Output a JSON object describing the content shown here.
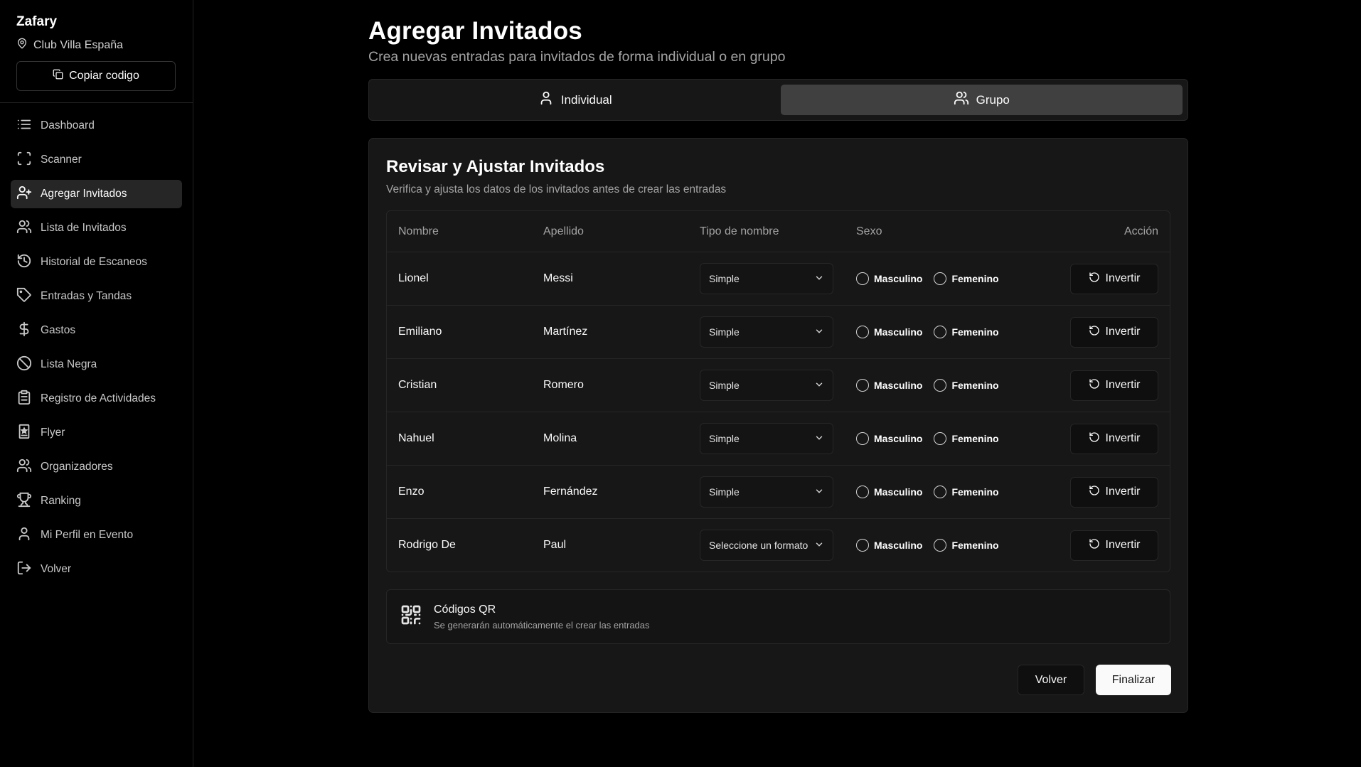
{
  "sidebar": {
    "brand": "Zafary",
    "venue": "Club Villa España",
    "copy_label": "Copiar codigo",
    "items": [
      {
        "label": "Dashboard",
        "icon": "list-icon"
      },
      {
        "label": "Scanner",
        "icon": "scan-icon"
      },
      {
        "label": "Agregar Invitados",
        "icon": "user-plus-icon",
        "active": true
      },
      {
        "label": "Lista de Invitados",
        "icon": "users-icon"
      },
      {
        "label": "Historial de Escaneos",
        "icon": "history-icon"
      },
      {
        "label": "Entradas y Tandas",
        "icon": "tag-icon"
      },
      {
        "label": "Gastos",
        "icon": "dollar-icon"
      },
      {
        "label": "Lista Negra",
        "icon": "ban-icon"
      },
      {
        "label": "Registro de Actividades",
        "icon": "clipboard-icon"
      },
      {
        "label": "Flyer",
        "icon": "flyer-icon"
      },
      {
        "label": "Organizadores",
        "icon": "users-icon"
      },
      {
        "label": "Ranking",
        "icon": "trophy-icon"
      },
      {
        "label": "Mi Perfil en Evento",
        "icon": "user-icon"
      },
      {
        "label": "Volver",
        "icon": "logout-icon"
      }
    ]
  },
  "header": {
    "title": "Agregar Invitados",
    "subtitle": "Crea nuevas entradas para invitados de forma individual o en grupo"
  },
  "tabs": [
    {
      "label": "Individual",
      "active": false
    },
    {
      "label": "Grupo",
      "active": true
    }
  ],
  "card": {
    "title": "Revisar y Ajustar Invitados",
    "subtitle": "Verifica y ajusta los datos de los invitados antes de crear las entradas",
    "columns": [
      "Nombre",
      "Apellido",
      "Tipo de nombre",
      "Sexo",
      "Acción"
    ],
    "radio_labels": [
      "Masculino",
      "Femenino"
    ],
    "action_label": "Invertir",
    "rows": [
      {
        "nombre": "Lionel",
        "apellido": "Messi",
        "tipo": "Simple"
      },
      {
        "nombre": "Emiliano",
        "apellido": "Martínez",
        "tipo": "Simple"
      },
      {
        "nombre": "Cristian",
        "apellido": "Romero",
        "tipo": "Simple"
      },
      {
        "nombre": "Nahuel",
        "apellido": "Molina",
        "tipo": "Simple"
      },
      {
        "nombre": "Enzo",
        "apellido": "Fernández",
        "tipo": "Simple"
      },
      {
        "nombre": "Rodrigo De",
        "apellido": "Paul",
        "tipo": "Seleccione un formato"
      }
    ],
    "qr": {
      "title": "Códigos QR",
      "subtitle": "Se generarán automáticamente el crear las entradas"
    },
    "back_label": "Volver",
    "finish_label": "Finalizar"
  }
}
